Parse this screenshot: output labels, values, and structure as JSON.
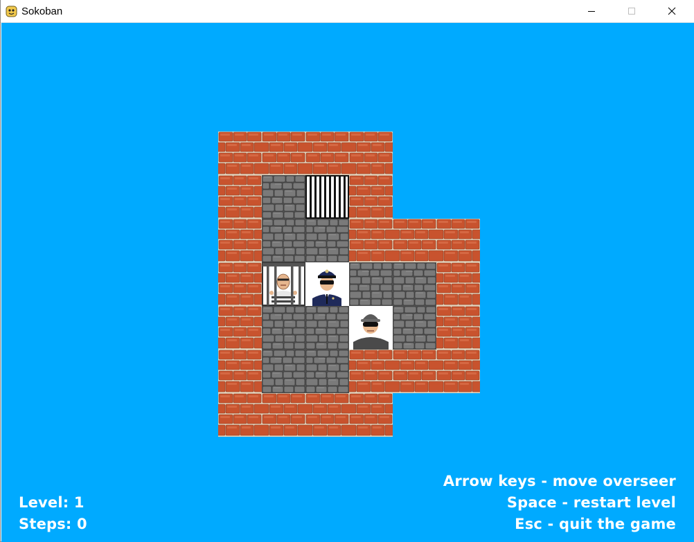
{
  "window": {
    "title": "Sokoban",
    "icon": "pygame-snake-icon",
    "controls": [
      "minimize",
      "maximize",
      "close"
    ]
  },
  "colors": {
    "background": "#00aaff",
    "brick": "#c8532e",
    "stone": "#6e6e6e",
    "hud_text": "#ffffff"
  },
  "board": {
    "legend": {
      "B": "brick wall",
      "F": "stone floor",
      "J": "empty jail cell (target)",
      "P": "prisoner in jail cell (crate on target)",
      "O": "overseer / police officer (player)",
      "R": "robber (crate)",
      ".": "empty"
    },
    "rows": [
      "BBBB..",
      "BFJB..",
      "BFFBBB",
      "BPOFFB",
      "BFFRFB",
      "BFFBBB",
      "BBBB.."
    ]
  },
  "hud": {
    "level_label": "Level: 1",
    "steps_label": "Steps: 0",
    "help": [
      "Arrow keys - move overseer",
      "Space - restart level",
      "Esc - quit the game"
    ]
  }
}
